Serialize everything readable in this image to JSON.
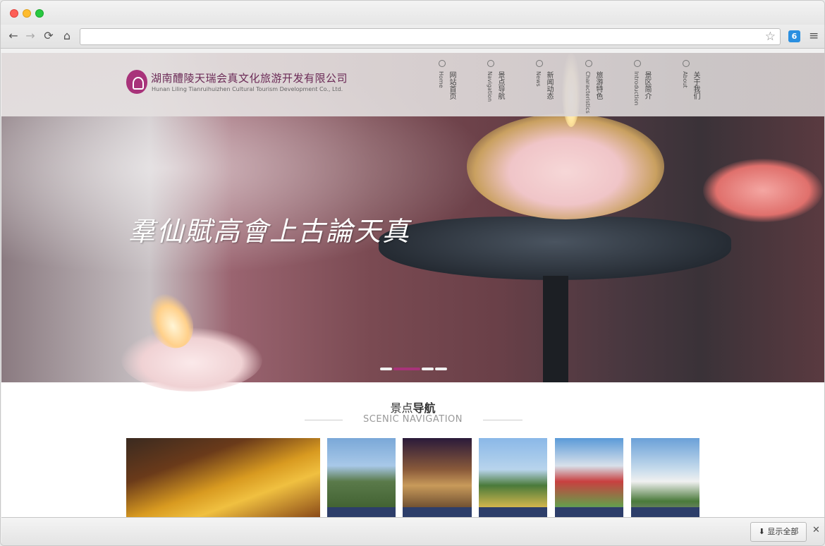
{
  "browser": {
    "back_icon": "←",
    "forward_icon": "→",
    "reload_icon": "⟳",
    "home_icon": "⌂",
    "star_icon": "☆",
    "ext_label": "6",
    "menu_icon": "≡"
  },
  "site": {
    "company_cn": "湖南醴陵天瑞会真文化旅游开发有限公司",
    "company_en": "Hunan Liling Tianruihuizhen Cultural Tourism Development Co., Ltd."
  },
  "nav": [
    {
      "cn": "网站首页",
      "en": "Home"
    },
    {
      "cn": "景点导航",
      "en": "Navigation"
    },
    {
      "cn": "新闻动态",
      "en": "News"
    },
    {
      "cn": "旅游特色",
      "en": "Characteristics"
    },
    {
      "cn": "景区简介",
      "en": "Introduction"
    },
    {
      "cn": "关于我们",
      "en": "About"
    }
  ],
  "banner": {
    "calligraphy": "羣仙賦高會上古論天真",
    "slides": 4,
    "active_slide": 2
  },
  "section": {
    "title_plain": "景点",
    "title_bold": "导航",
    "subtitle": "SCENIC NAVIGATION"
  },
  "downloads": {
    "show_all": "显示全部",
    "close_icon": "✕",
    "download_icon": "⬇"
  },
  "colors": {
    "brand": "#a8337a",
    "thumb_bar": "#2d3e6a"
  }
}
